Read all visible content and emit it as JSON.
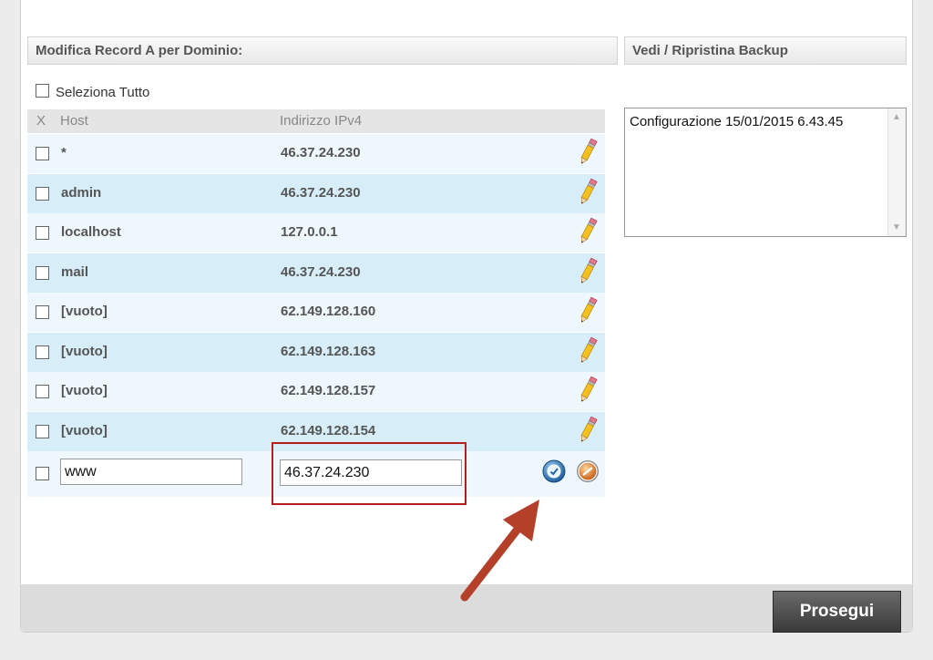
{
  "left_section": {
    "title": "Modifica Record A per Dominio:",
    "select_all_label": "Seleziona Tutto",
    "columns": {
      "x": "X",
      "host": "Host",
      "ip": "Indirizzo IPv4"
    },
    "records": [
      {
        "host": "*",
        "ip": "46.37.24.230"
      },
      {
        "host": "admin",
        "ip": "46.37.24.230"
      },
      {
        "host": "localhost",
        "ip": "127.0.0.1"
      },
      {
        "host": "mail",
        "ip": "46.37.24.230"
      },
      {
        "host": "[vuoto]",
        "ip": "62.149.128.160"
      },
      {
        "host": "[vuoto]",
        "ip": "62.149.128.163"
      },
      {
        "host": "[vuoto]",
        "ip": "62.149.128.157"
      },
      {
        "host": "[vuoto]",
        "ip": "62.149.128.154"
      }
    ],
    "edit_row": {
      "host_value": "www",
      "ip_value": "46.37.24.230"
    }
  },
  "right_section": {
    "title": "Vedi / Ripristina Backup",
    "backups": [
      "Configurazione 15/01/2015 6.43.45"
    ]
  },
  "footer": {
    "continue_label": "Prosegui"
  },
  "icons": {
    "edit": "pencil-icon",
    "confirm": "check-clock-icon",
    "cancel": "cancel-icon",
    "annotation": "red-arrow"
  },
  "colors": {
    "row_light": "#eef7fc",
    "row_dark": "#d7eef9",
    "highlight": "#b31e1e",
    "arrow": "#b5402a"
  }
}
